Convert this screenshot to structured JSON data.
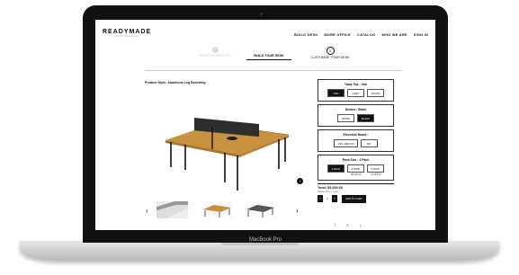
{
  "nav": {
    "logo": "READYMADE",
    "logo_sub": "OFFICE FURNITURE",
    "links": [
      "BUILD DESK",
      "MORE OFFICE",
      "CATALOG",
      "WHO WE ARE",
      "SIGN IN"
    ]
  },
  "steps": [
    {
      "label": "SELECT FURNITURE",
      "state": "done"
    },
    {
      "label": "BUILD YOUR DESK",
      "state": "active"
    },
    {
      "number": "2",
      "label": "CUSTOMIZE YOUR DESK",
      "state": "next"
    }
  ],
  "product_title": "Product Style: Aluminum Leg Benching",
  "config": {
    "table_top": {
      "title": "Table Top : Oak",
      "options": [
        "OAK",
        "GREY",
        "WHITE"
      ],
      "selected": 0
    },
    "divider": {
      "title": "Divider : Black",
      "options": [
        "WHITE",
        "BLACK"
      ],
      "selected": 1
    },
    "electrical": {
      "title": "Electrical Board :",
      "options": [
        "YES +$100.00",
        "NO"
      ],
      "selected": -1
    },
    "pack_size": {
      "title": "Pack Size : 2 Pack",
      "options": [
        "2 PACK",
        "4 PACK",
        "6 PACK"
      ],
      "prices": [
        "",
        "+$3,000.00",
        "+$4,000.00"
      ],
      "selected": 0
    }
  },
  "total": "Total: $3,000.00",
  "quantity_label": "Website Price / 1 sets",
  "quantity": "1",
  "add_to_cart": "ADD TO CART",
  "device_label": "MacBook Pro",
  "icons": {
    "prev": "chevron-left-icon",
    "next": "chevron-right-icon",
    "info": "info-icon"
  },
  "colors": {
    "accent": "#111111",
    "oak": "#c8913f",
    "divider": "#2e2e2e"
  }
}
